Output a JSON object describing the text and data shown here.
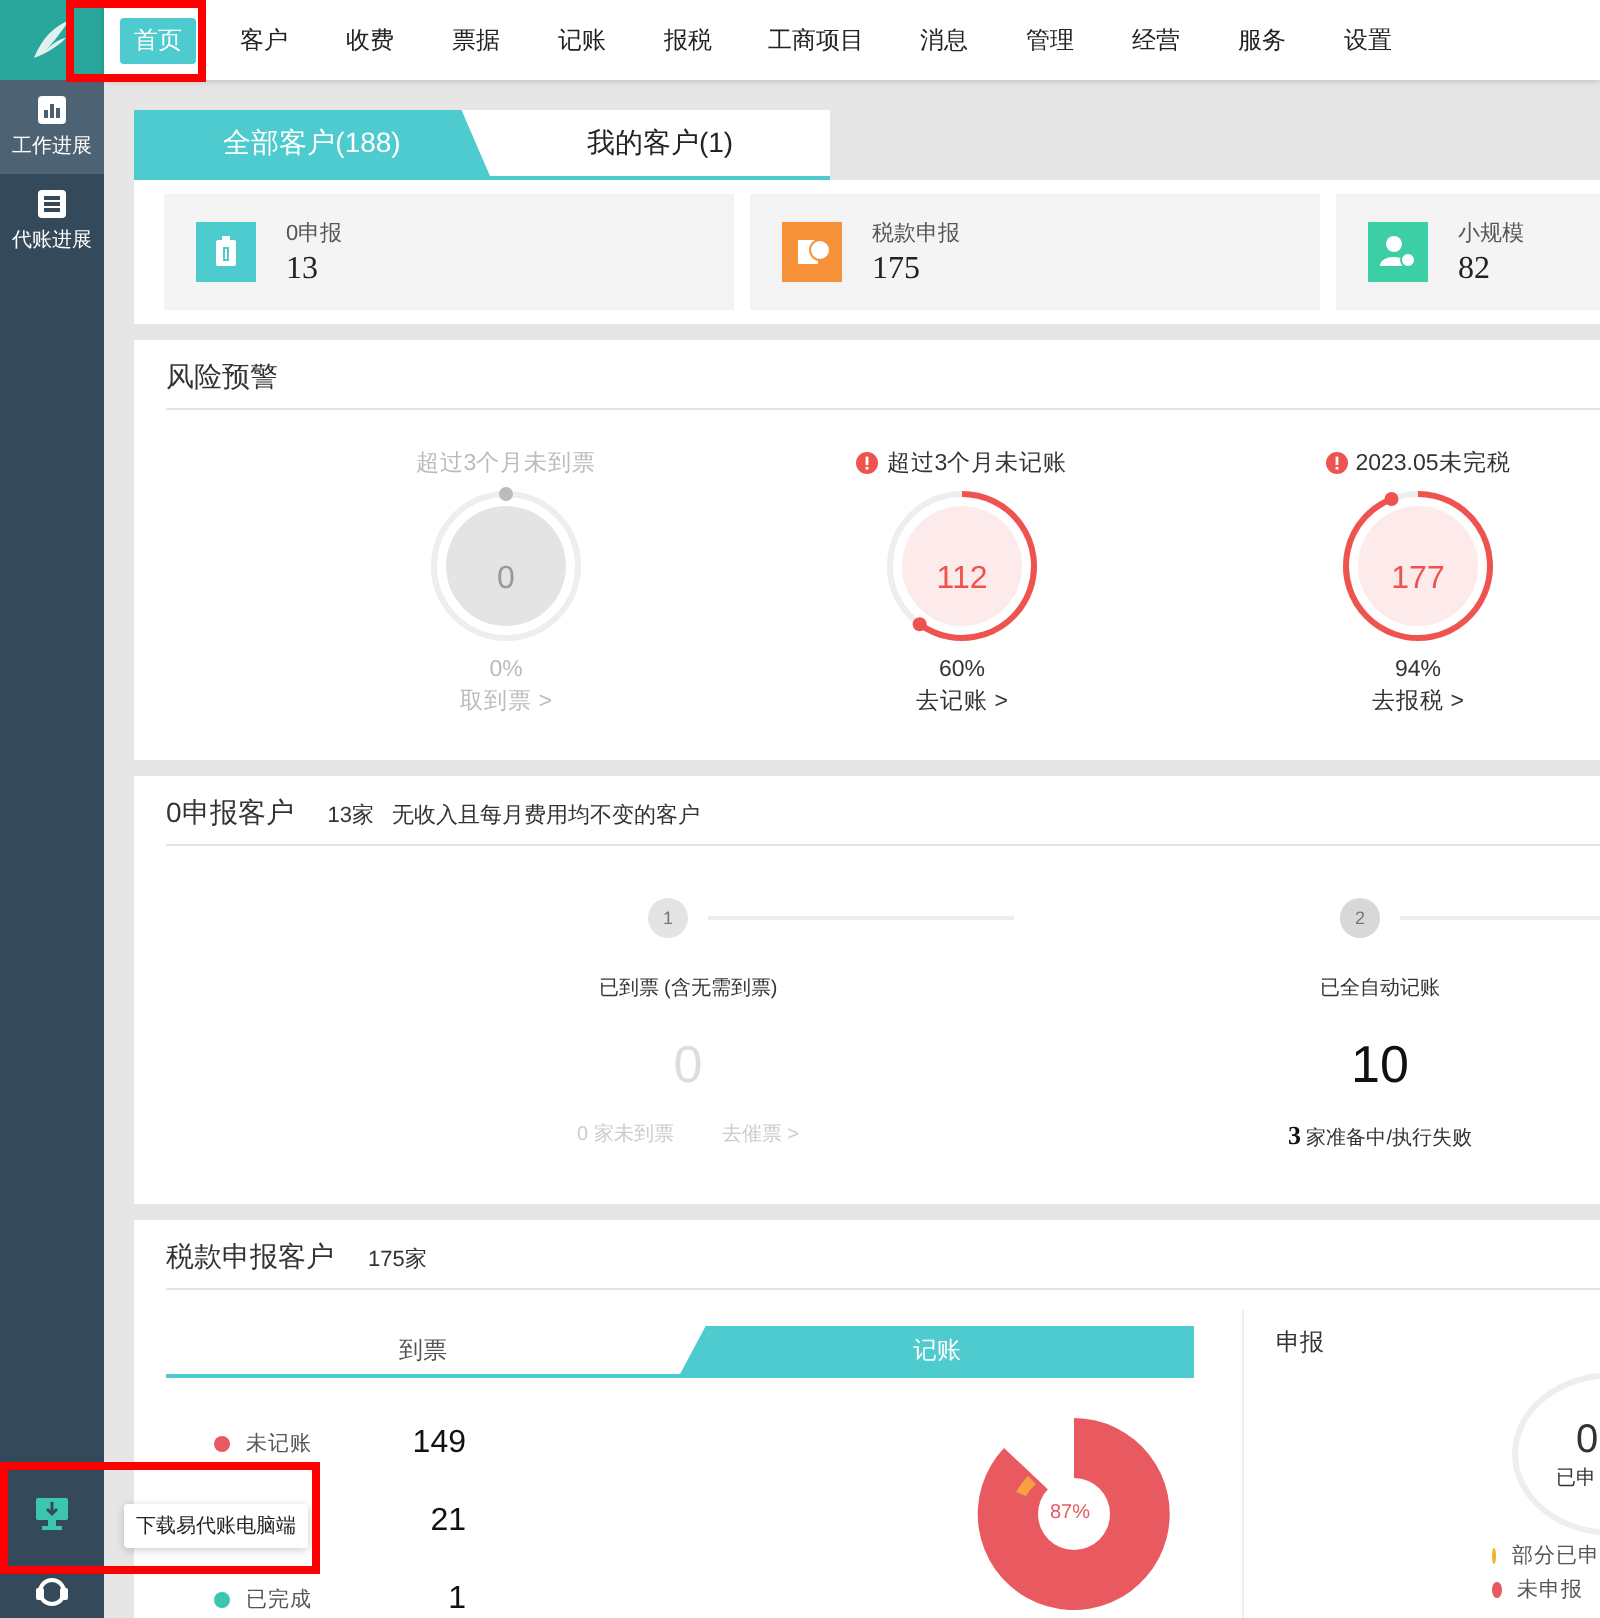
{
  "nav": {
    "items": [
      {
        "label": "首页",
        "selected": true
      },
      {
        "label": "客户",
        "selected": false
      },
      {
        "label": "收费",
        "selected": false
      },
      {
        "label": "票据",
        "selected": false
      },
      {
        "label": "记账",
        "selected": false
      },
      {
        "label": "报税",
        "selected": false
      },
      {
        "label": "工商项目",
        "selected": false
      },
      {
        "label": "消息",
        "selected": false
      },
      {
        "label": "管理",
        "selected": false
      },
      {
        "label": "经营",
        "selected": false
      },
      {
        "label": "服务",
        "selected": false
      },
      {
        "label": "设置",
        "selected": false
      }
    ]
  },
  "sidebar": {
    "items": [
      {
        "label": "工作进展",
        "kind": "chart",
        "selected": true
      },
      {
        "label": "代账进展",
        "kind": "list",
        "selected": false
      }
    ]
  },
  "tooltip": {
    "text": "下载易代账电脑端"
  },
  "customer_tabs": [
    {
      "label": "全部客户(188)",
      "selected": true
    },
    {
      "label": "我的客户(1)",
      "selected": false
    }
  ],
  "stats": [
    {
      "label": "0申报",
      "value": "13",
      "kind": "zero",
      "color": "#4ecbcf"
    },
    {
      "label": "税款申报",
      "value": "175",
      "kind": "tax",
      "color": "#f7923a"
    },
    {
      "label": "小规模",
      "value": "82",
      "kind": "small",
      "color": "#3ccfa6"
    }
  ],
  "risk": {
    "title": "风险预警",
    "items": [
      {
        "title": "超过3个月未到票",
        "alert": false,
        "value": "0",
        "percent": "0%",
        "link": "取到票 >"
      },
      {
        "title": "超过3个月未记账",
        "alert": true,
        "value": "112",
        "percent": "60%",
        "link": "去记账 >"
      },
      {
        "title": "2023.05未完税",
        "alert": true,
        "value": "177",
        "percent": "94%",
        "link": "去报税 >"
      }
    ]
  },
  "zero_report": {
    "title": "0申报客户",
    "count": "13家",
    "description": "无收入且每月费用均不变的客户",
    "steps": [
      {
        "number": "1",
        "title": "已到票 (含无需到票)",
        "value": "0",
        "active": false,
        "notes": [
          "0 家未到票",
          "去催票 >"
        ]
      },
      {
        "number": "2",
        "title": "已全自动记账",
        "value": "10",
        "active": true,
        "notes": [
          "**3** 家准备中/执行失败"
        ]
      }
    ]
  },
  "tax_report": {
    "title": "税款申报客户",
    "count": "175家",
    "tabs": [
      {
        "label": "到票",
        "selected": false
      },
      {
        "label": "记账",
        "selected": true
      }
    ],
    "legend": [
      {
        "label": "未记账",
        "color": "#e85a60",
        "value": "149"
      },
      {
        "value": "21"
      },
      {
        "label": "已完成",
        "color": "#3cc6b0",
        "value": "1"
      }
    ],
    "chart_label": "87%",
    "declare": {
      "title": "申报",
      "value": "0",
      "caption": "已申",
      "legend": [
        {
          "label": "部分已申",
          "color": "#f0b429"
        },
        {
          "label": "未申报",
          "color": "#e85a60"
        }
      ]
    }
  }
}
